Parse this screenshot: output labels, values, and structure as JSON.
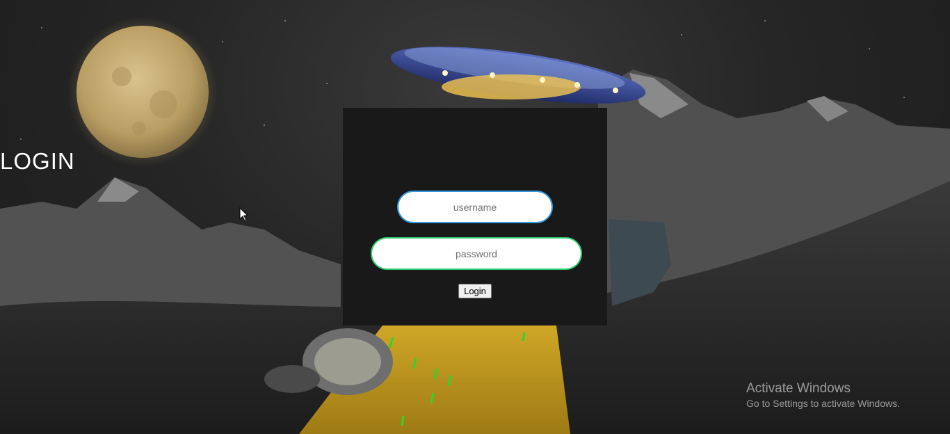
{
  "login": {
    "title": "LOGIN",
    "username_placeholder": "username",
    "password_placeholder": "password",
    "button_label": "Login"
  },
  "watermark": {
    "title": "Activate Windows",
    "subtitle": "Go to Settings to activate Windows."
  },
  "colors": {
    "card_background": "#191919",
    "username_border": "#3498db",
    "password_border": "#2ecc71",
    "beam": "#d8a820",
    "moon": "#c9b07a"
  },
  "background": {
    "icons": [
      "moon-icon",
      "ufo-icon",
      "mountain-icon",
      "crashed-capsule-icon",
      "mouse-cursor-icon"
    ]
  }
}
